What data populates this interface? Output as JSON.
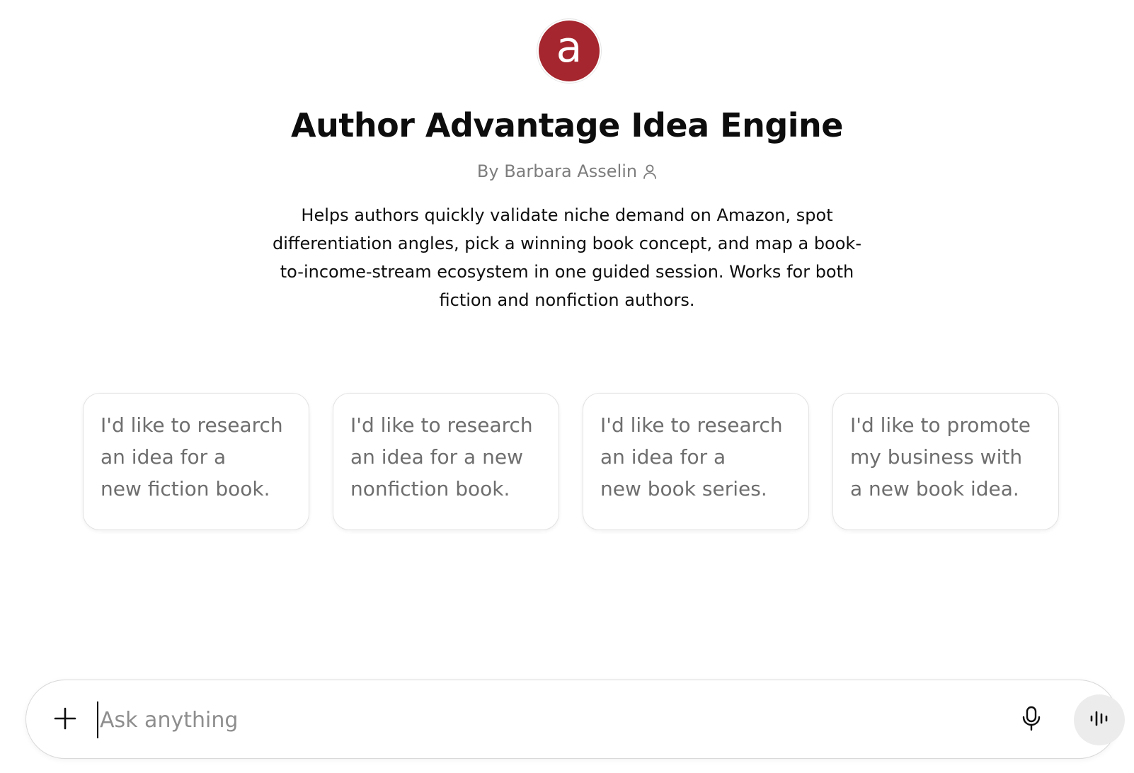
{
  "gpt": {
    "logo_letter": "a",
    "logo_color": "#a5262e",
    "title": "Author Advantage Idea Engine",
    "byline": "By Barbara Asselin",
    "byline_icon": "person-icon",
    "description": "Helps authors quickly validate niche demand on Amazon, spot differentiation angles, pick a winning book concept, and map a book-to-income-stream ecosystem in one guided session. Works for both fiction and nonfiction authors."
  },
  "suggestions": [
    {
      "label": "I'd like to research\nan idea for a\nnew fiction book."
    },
    {
      "label": "I'd like to research\nan idea for a new\nnonfiction book."
    },
    {
      "label": "I'd like to research\nan idea for a\nnew book series."
    },
    {
      "label": "I'd like to promote\nmy business with\na new book idea."
    }
  ],
  "composer": {
    "placeholder": "Ask anything",
    "value": "",
    "attach_icon": "plus-icon",
    "mic_icon": "microphone-icon",
    "voice_icon": "voice-waveform-icon"
  }
}
